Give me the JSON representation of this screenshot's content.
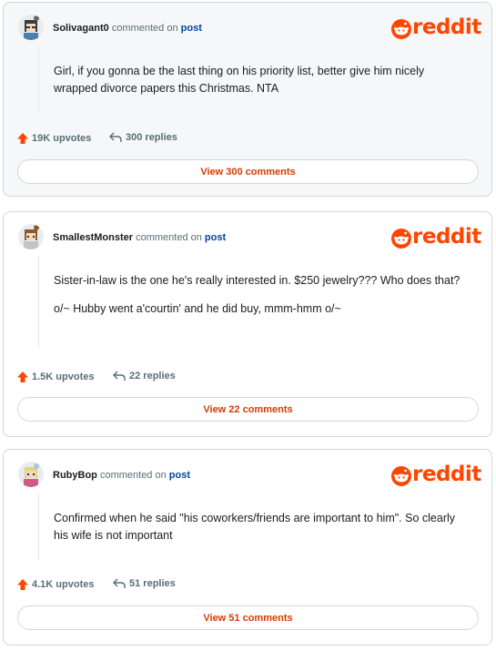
{
  "comments": [
    {
      "username": "Solivagant0",
      "commented_on": "commented on",
      "post_link": "post",
      "logo_text": "reddit",
      "paragraphs": [
        "Girl, if you gonna be the last thing on his priority list, better give him nicely wrapped divorce papers this Christmas. NTA"
      ],
      "upvotes": "19K upvotes",
      "replies": "300 replies",
      "view_button": "View 300 comments",
      "avatar_icon": "avatar-dark-hair-icon"
    },
    {
      "username": "SmallestMonster",
      "commented_on": "commented on",
      "post_link": "post",
      "logo_text": "reddit",
      "paragraphs": [
        "Sister-in-law is the one he's really interested in. $250 jewelry??? Who does that?",
        "o/~ Hubby went a'courtin' and he did buy, mmm-hmm o/~"
      ],
      "upvotes": "1.5K upvotes",
      "replies": "22 replies",
      "view_button": "View 22 comments",
      "avatar_icon": "avatar-brown-hair-icon"
    },
    {
      "username": "RubyBop",
      "commented_on": "commented on",
      "post_link": "post",
      "logo_text": "reddit",
      "paragraphs": [
        "Confirmed when he said \"his coworkers/friends are important to him\". So clearly his wife is not important"
      ],
      "upvotes": "4.1K upvotes",
      "replies": "51 replies",
      "view_button": "View 51 comments",
      "avatar_icon": "avatar-light-hair-icon"
    }
  ],
  "colors": {
    "brand": "#ff4500",
    "link": "#0045ac",
    "button_text": "#d93a00",
    "meta": "#576f76"
  }
}
